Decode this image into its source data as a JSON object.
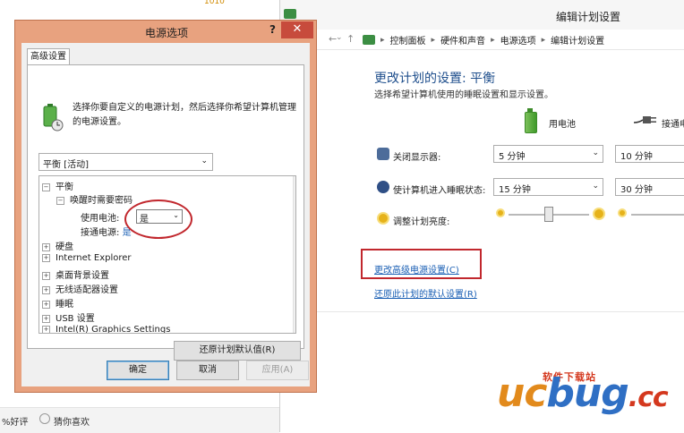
{
  "background": {
    "top_fragment": "1010",
    "bottom_left_text": "%好评",
    "bottom_guess_text": "猜你喜欢"
  },
  "control_panel": {
    "title": "编辑计划设置",
    "breadcrumbs": [
      "控制面板",
      "硬件和声音",
      "电源选项",
      "编辑计划设置"
    ],
    "heading": "更改计划的设置: 平衡",
    "subheading": "选择希望计算机使用的睡眠设置和显示设置。",
    "columns": {
      "battery": "用电池",
      "plugged": "接通电"
    },
    "rows": [
      {
        "label": "关闭显示器:",
        "battery_value": "5 分钟",
        "plugged_value": "10 分钟",
        "icon": "display-off-icon"
      },
      {
        "label": "使计算机进入睡眠状态:",
        "battery_value": "15 分钟",
        "plugged_value": "30 分钟",
        "icon": "sleep-icon"
      },
      {
        "label": "调整计划亮度:",
        "icon": "brightness-icon"
      }
    ],
    "brightness_battery_level": 0.5,
    "link_advanced": "更改高级电源设置(C)",
    "link_restore": "还原此计划的默认设置(R)",
    "accent_red": "#c1272d"
  },
  "dialog": {
    "title": "电源选项",
    "help": "?",
    "close": "✕",
    "tab": "高级设置",
    "description": "选择你要自定义的电源计划，然后选择你希望计算机管理的电源设置。",
    "plan_value": "平衡 [活动]",
    "tree": [
      {
        "label": "平衡",
        "toggle": "⊟"
      },
      {
        "label": "唤醒时需要密码",
        "toggle": "⊟"
      },
      {
        "label": "使用电池:",
        "value": "是"
      },
      {
        "label": "接通电源:",
        "value": "是"
      },
      {
        "label": "硬盘",
        "toggle": "⊞"
      },
      {
        "label": "Internet Explorer",
        "toggle": "⊞"
      },
      {
        "label": "桌面背景设置",
        "toggle": "⊞"
      },
      {
        "label": "无线适配器设置",
        "toggle": "⊞"
      },
      {
        "label": "睡眠",
        "toggle": "⊞"
      },
      {
        "label": "USB 设置",
        "toggle": "⊞"
      },
      {
        "label": "Intel(R) Graphics Settings",
        "toggle": "⊞"
      }
    ],
    "buttons": {
      "restore": "还原计划默认值(R)",
      "ok": "确定",
      "cancel": "取消",
      "apply": "应用(A)"
    }
  },
  "watermark": {
    "text": "软件下载站",
    "logo_u": "u",
    "logo_c": "c",
    "logo_bug": "bug",
    "logo_dot": ".cc"
  }
}
